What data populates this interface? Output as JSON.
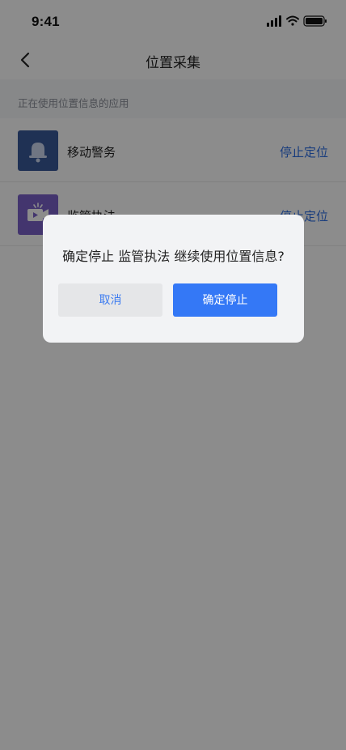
{
  "status_bar": {
    "time": "9:41"
  },
  "nav": {
    "title": "位置采集"
  },
  "section": {
    "header": "正在使用位置信息的应用"
  },
  "apps": [
    {
      "name": "移动警务",
      "action": "停止定位",
      "icon": "bell-icon",
      "color": "#3a5a9a"
    },
    {
      "name": "监管执法",
      "action": "停止定位",
      "icon": "video-icon",
      "color": "#7a62c9"
    }
  ],
  "dialog": {
    "message": "确定停止 监管执法 继续使用位置信息?",
    "cancel_label": "取消",
    "confirm_label": "确定停止"
  },
  "colors": {
    "accent": "#3478f6",
    "link": "#2f6fe4",
    "overlay": "rgba(0,0,0,0.45)"
  }
}
